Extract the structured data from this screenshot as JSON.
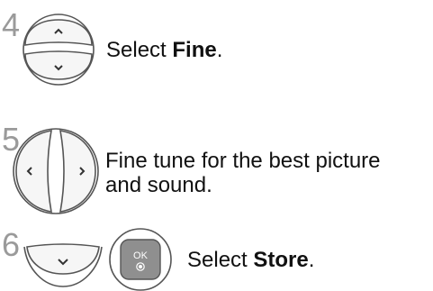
{
  "steps": [
    {
      "number": "4",
      "text_before": "Select ",
      "text_bold": "Fine",
      "text_after": ".",
      "controls": [
        "up-key",
        "down-key"
      ]
    },
    {
      "number": "5",
      "line1": "Fine tune for the best picture",
      "line2": "and sound.",
      "controls": [
        "left-key",
        "right-key"
      ]
    },
    {
      "number": "6",
      "text_before": "Select ",
      "text_bold": "Store",
      "text_after": ".",
      "controls": [
        "down-key",
        "ok-button"
      ],
      "ok_label": "OK"
    }
  ],
  "colors": {
    "key_border": "#555555",
    "key_fill": "#f6f6f6",
    "ok_fill": "#8f8f8f",
    "step_number": "#9a9a9a"
  }
}
